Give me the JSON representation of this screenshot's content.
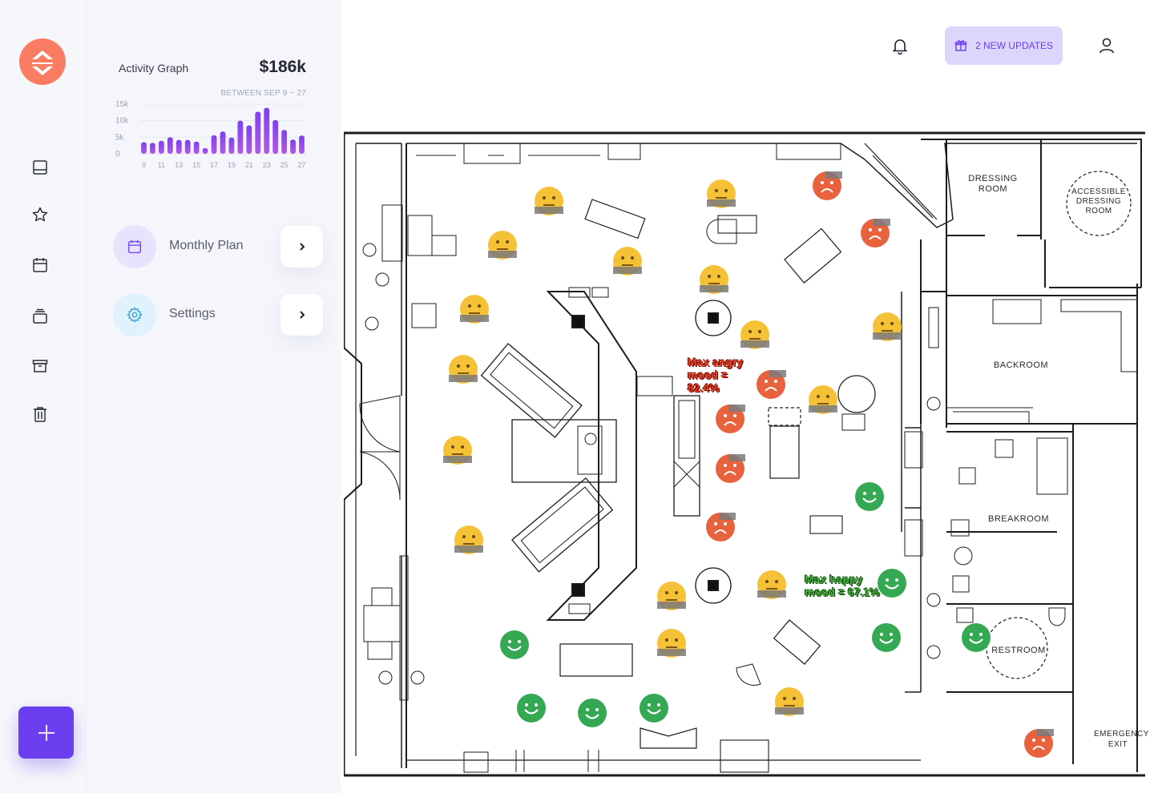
{
  "activity": {
    "title": "Activity Graph",
    "total": "$186k",
    "range": "BETWEEN SEP 9 ~ 27",
    "y_ticks": [
      "15k",
      "10k",
      "5k",
      "0"
    ],
    "x_ticks": [
      "9",
      "11",
      "13",
      "15",
      "17",
      "19",
      "21",
      "23",
      "25",
      "27"
    ]
  },
  "chart_data": {
    "type": "bar",
    "title": "Activity Graph",
    "ylim": [
      0,
      15000
    ],
    "categories": [
      "9",
      "10",
      "11",
      "12",
      "13",
      "14",
      "15",
      "16",
      "17",
      "18",
      "19",
      "20",
      "21",
      "22",
      "23",
      "24",
      "25",
      "26",
      "27"
    ],
    "values": [
      3500,
      3300,
      3900,
      5000,
      4200,
      4200,
      3700,
      1700,
      5600,
      6700,
      4900,
      10000,
      8600,
      12700,
      13900,
      10200,
      7200,
      4300,
      5500
    ],
    "colors": [
      "#7f3ff0",
      "#b05ae6"
    ]
  },
  "menu": {
    "items": [
      {
        "label": "Monthly Plan"
      },
      {
        "label": "Settings"
      }
    ]
  },
  "topbar": {
    "updates_label": "2 NEW UPDATES"
  },
  "floorplan": {
    "rooms": [
      "DRESSING ROOM",
      "ACCESSIBLE DRESSING ROOM",
      "BACKROOM",
      "BREAKROOM",
      "RESTROOM",
      "EMERGENCY EXIT"
    ],
    "annotations": {
      "angry": "Max angry mood = 82.4%",
      "happy": "Max happy mood = 67.1%"
    },
    "colors": {
      "neutral": "#f5c137",
      "angry": "#e8623e",
      "happy": "#35a853"
    }
  }
}
